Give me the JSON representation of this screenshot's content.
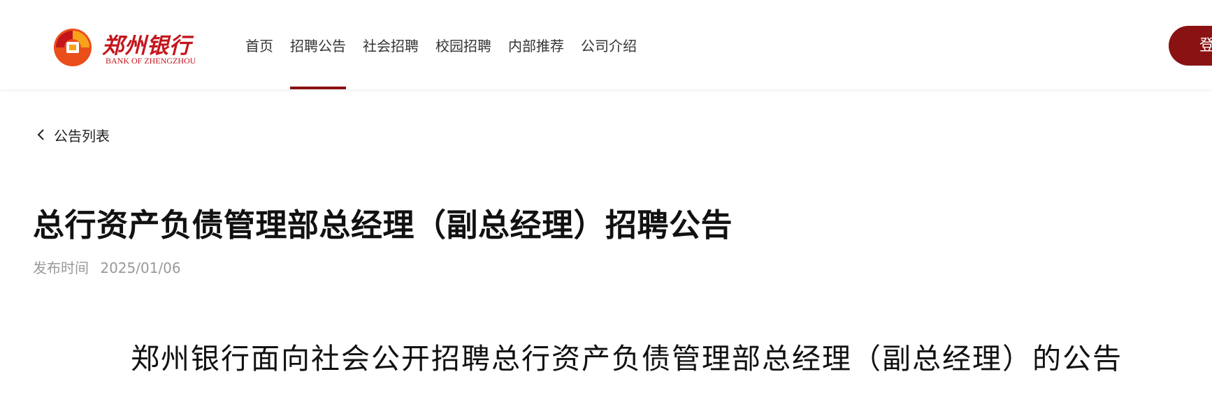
{
  "brand": {
    "name_cn": "郑州银行",
    "name_en": "BANK OF ZHENGZHOU",
    "primary_color": "#c4151c",
    "accent_color": "#8b1212"
  },
  "nav": {
    "items": [
      {
        "label": "首页",
        "active": false
      },
      {
        "label": "招聘公告",
        "active": true
      },
      {
        "label": "社会招聘",
        "active": false
      },
      {
        "label": "校园招聘",
        "active": false
      },
      {
        "label": "内部推荐",
        "active": false
      },
      {
        "label": "公司介绍",
        "active": false
      }
    ],
    "login_label": "登"
  },
  "breadcrumb": {
    "back_icon": "chevron-left-icon",
    "back_label": "公告列表"
  },
  "article": {
    "title": "总行资产负债管理部总经理（副总经理）招聘公告",
    "meta_label": "发布时间",
    "meta_date": "2025/01/06",
    "content_heading": "郑州银行面向社会公开招聘总行资产负债管理部总经理（副总经理）的公告"
  }
}
